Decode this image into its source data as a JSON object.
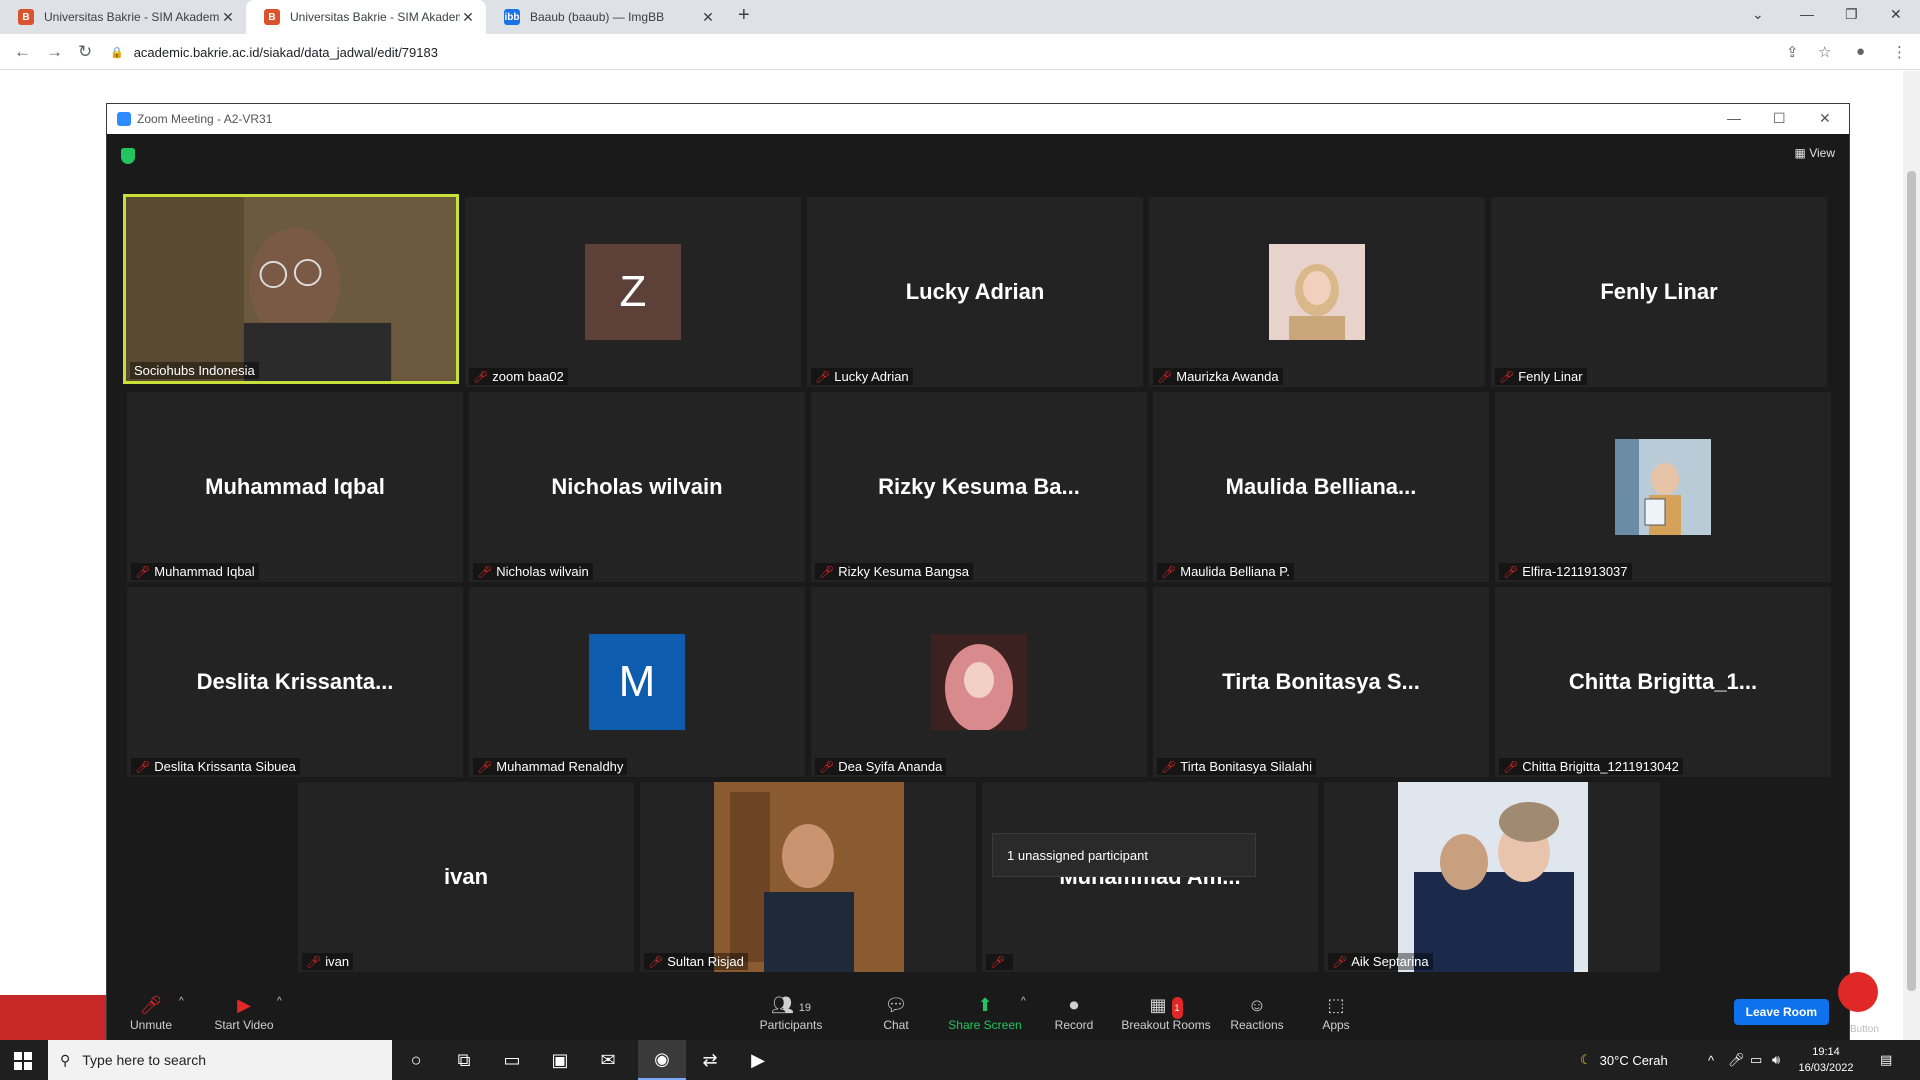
{
  "browser": {
    "tabs": [
      {
        "title": "Universitas Bakrie - SIM Akadem",
        "icon": "ub-favicon",
        "active": false
      },
      {
        "title": "Universitas Bakrie - SIM Akadem",
        "icon": "ub-favicon",
        "active": true
      },
      {
        "title": "Baaub (baaub) — ImgBB",
        "icon": "imgbb-favicon",
        "active": false
      }
    ],
    "url": "academic.bakrie.ac.id/siakad/data_jadwal/edit/79183"
  },
  "zoom": {
    "window_title": "Zoom Meeting - A2-VR31",
    "view_label": "View",
    "participants": [
      {
        "name": "Sociohubs Indonesia",
        "display": "video",
        "active": true
      },
      {
        "name": "zoom baa02",
        "display": "letter",
        "letter": "Z",
        "color": "#5d4037"
      },
      {
        "name": "Lucky Adrian",
        "display": "name",
        "big": "Lucky Adrian"
      },
      {
        "name": "Maurizka Awanda",
        "display": "photo",
        "color": "#e8c7c0"
      },
      {
        "name": "Fenly Linar",
        "display": "name",
        "big": "Fenly Linar"
      },
      {
        "name": "Muhammad Iqbal",
        "display": "name",
        "big": "Muhammad Iqbal"
      },
      {
        "name": "Nicholas wilvain",
        "display": "name",
        "big": "Nicholas wilvain"
      },
      {
        "name": "Rizky Kesuma Bangsa",
        "display": "name",
        "big": "Rizky  Kesuma  Ba..."
      },
      {
        "name": "Maulida Belliana P.",
        "display": "name",
        "big": "Maulida  Belliana..."
      },
      {
        "name": "Elfira-1211913037",
        "display": "photo",
        "color": "#c9b5a0"
      },
      {
        "name": "Deslita Krissanta Sibuea",
        "display": "name",
        "big": "Deslita  Krissanta..."
      },
      {
        "name": "Muhammad Renaldhy",
        "display": "letter",
        "letter": "M",
        "color": "#0e5cad"
      },
      {
        "name": "Dea Syifa Ananda",
        "display": "photo",
        "color": "#d98a8c"
      },
      {
        "name": "Tirta Bonitasya Silalahi",
        "display": "name",
        "big": "Tirta  Bonitasya  S..."
      },
      {
        "name": "Chitta Brigitta_1211913042",
        "display": "name",
        "big": "Chitta  Brigitta_1..."
      },
      {
        "name": "ivan",
        "display": "name",
        "big": "ivan"
      },
      {
        "name": "Sultan Risjad",
        "display": "video2"
      },
      {
        "name": "",
        "display": "name",
        "big": "Muhammad  Am..."
      },
      {
        "name": "Aik Septarina",
        "display": "video3"
      }
    ],
    "tooltip": "1 unassigned participant",
    "controls": {
      "unmute": "Unmute",
      "start_video": "Start Video",
      "participants": "Participants",
      "participants_count": "19",
      "chat": "Chat",
      "share_screen": "Share Screen",
      "record": "Record",
      "breakout_rooms": "Breakout Rooms",
      "breakout_badge": "1",
      "reactions": "Reactions",
      "apps": "Apps",
      "leave_room": "Leave Room",
      "side_button": "Button"
    }
  },
  "taskbar": {
    "search_placeholder": "Type here to search",
    "weather": "30°C  Cerah",
    "time": "19:14",
    "date": "16/03/2022"
  }
}
